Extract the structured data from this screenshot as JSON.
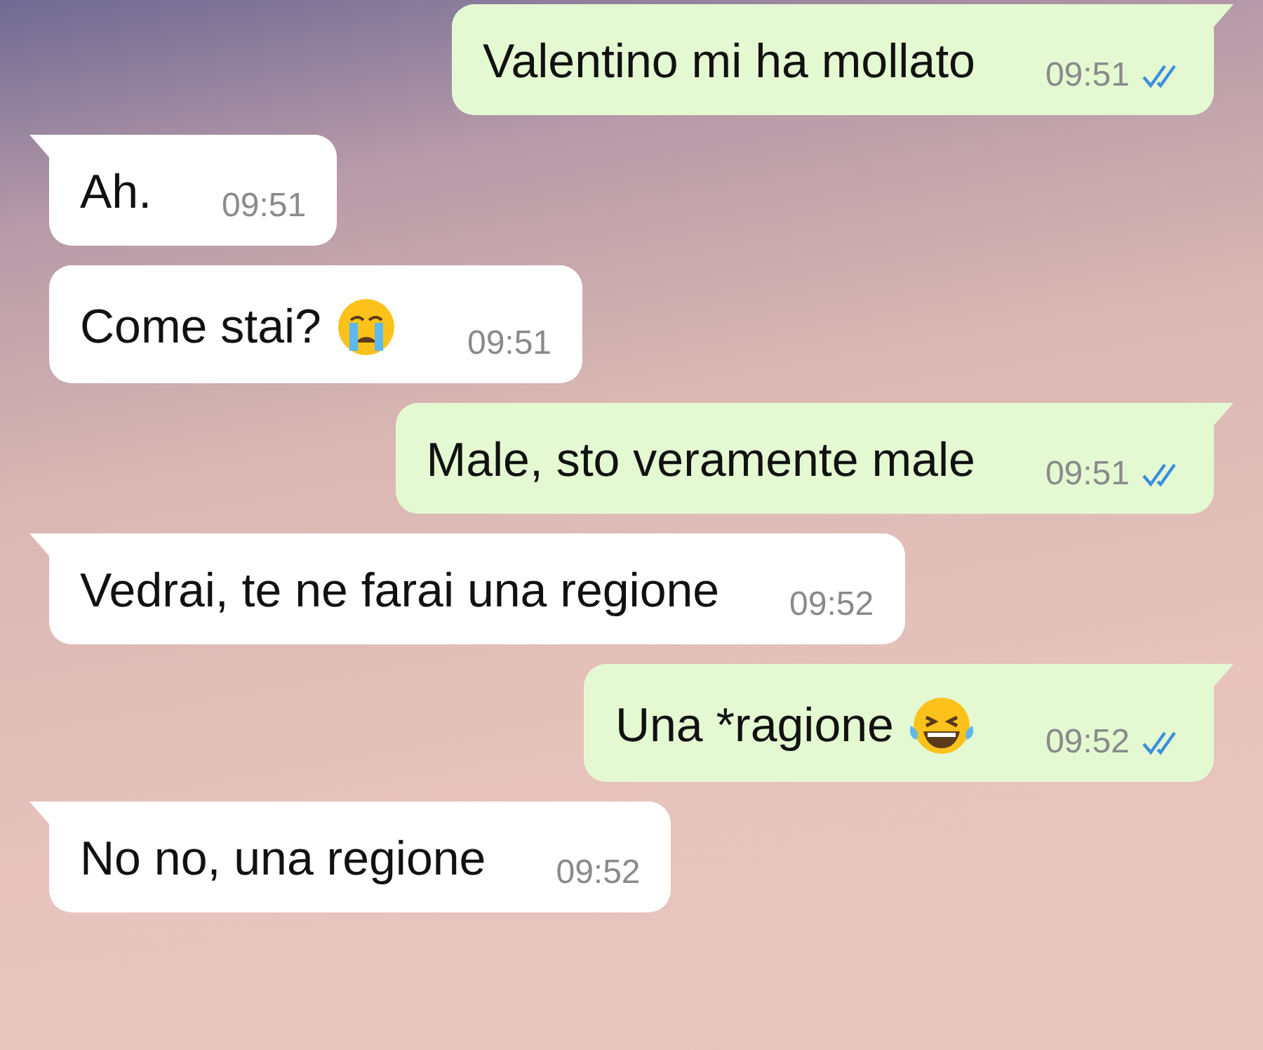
{
  "messages": [
    {
      "kind": "sent",
      "text": "Valentino mi ha mollato",
      "time": "09:51",
      "read": true,
      "tail": true
    },
    {
      "kind": "received",
      "text": "Ah.",
      "time": "09:51",
      "tail": true
    },
    {
      "kind": "received",
      "text": "Come stai?",
      "emoji": {
        "kind": "crying"
      },
      "time": "09:51",
      "tail": false
    },
    {
      "kind": "sent",
      "text": "Male, sto veramente male",
      "time": "09:51",
      "read": true,
      "tail": true
    },
    {
      "kind": "received",
      "text": "Vedrai, te ne farai una regione",
      "time": "09:52",
      "tail": true
    },
    {
      "kind": "sent",
      "text": "Una *ragione",
      "emoji": {
        "kind": "laughing"
      },
      "time": "09:52",
      "read": true,
      "tail": true
    },
    {
      "kind": "received",
      "text": "No no, una regione",
      "time": "09:52",
      "tail": true
    }
  ]
}
